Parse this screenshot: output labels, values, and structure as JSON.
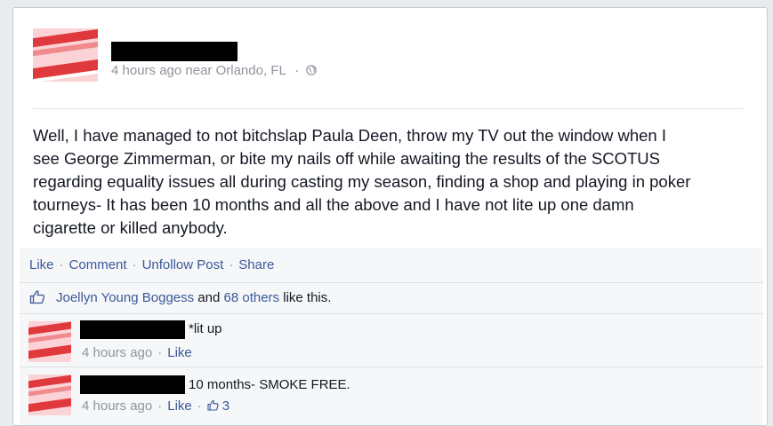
{
  "post": {
    "timestamp": "4 hours ago",
    "location": "near Orlando, FL",
    "dot": "·",
    "privacy_icon": "globe-icon",
    "body": "Well, I have managed to not bitchslap Paula Deen, throw my TV out the window when I\nsee George Zimmerman, or bite my nails off while awaiting the results of the SCOTUS\nregarding equality issues all during casting my season, finding a shop and playing in poker\ntourneys- It has been 10 months and all the above and I have not lite up one damn\ncigarette or killed anybody."
  },
  "actions": {
    "like": "Like",
    "comment": "Comment",
    "unfollow": "Unfollow Post",
    "share": "Share",
    "sep": "·"
  },
  "likes": {
    "icon": "thumbs-up-icon",
    "name": "Joellyn Young Boggess",
    "and": " and ",
    "others": "68 others",
    "suffix": " like this."
  },
  "comments": [
    {
      "text": "*lit up",
      "timestamp": "4 hours ago",
      "like": "Like"
    },
    {
      "text": "10 months- SMOKE FREE.",
      "timestamp": "4 hours ago",
      "like": "Like",
      "like_count": "3"
    }
  ],
  "colors": {
    "link": "#3b5998",
    "meta": "#90949c",
    "avatar_pink": "#fbd3d6",
    "avatar_red": "#e03a3e"
  }
}
